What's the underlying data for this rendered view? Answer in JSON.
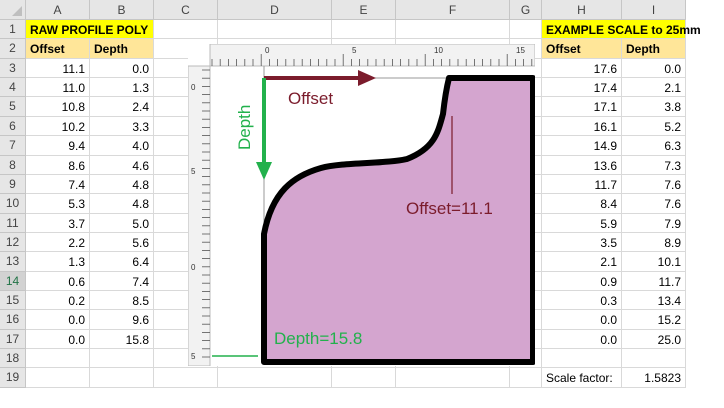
{
  "columns": [
    "A",
    "B",
    "C",
    "D",
    "E",
    "F",
    "G",
    "H",
    "I"
  ],
  "rows": [
    "1",
    "2",
    "3",
    "4",
    "5",
    "6",
    "7",
    "8",
    "9",
    "10",
    "11",
    "12",
    "13",
    "14",
    "15",
    "16",
    "17",
    "18",
    "19"
  ],
  "selected_row": "14",
  "raw": {
    "title": "RAW PROFILE POLY",
    "headers": [
      "Offset",
      "Depth"
    ],
    "data": [
      [
        "11.1",
        "0.0"
      ],
      [
        "11.0",
        "1.3"
      ],
      [
        "10.8",
        "2.4"
      ],
      [
        "10.2",
        "3.3"
      ],
      [
        "9.4",
        "4.0"
      ],
      [
        "8.6",
        "4.6"
      ],
      [
        "7.4",
        "4.8"
      ],
      [
        "5.3",
        "4.8"
      ],
      [
        "3.7",
        "5.0"
      ],
      [
        "2.2",
        "5.6"
      ],
      [
        "1.3",
        "6.4"
      ],
      [
        "0.6",
        "7.4"
      ],
      [
        "0.2",
        "8.5"
      ],
      [
        "0.0",
        "9.6"
      ],
      [
        "0.0",
        "15.8"
      ]
    ]
  },
  "scaled": {
    "title": "EXAMPLE SCALE to 25mm",
    "headers": [
      "Offset",
      "Depth"
    ],
    "data": [
      [
        "17.6",
        "0.0"
      ],
      [
        "17.4",
        "2.1"
      ],
      [
        "17.1",
        "3.8"
      ],
      [
        "16.1",
        "5.2"
      ],
      [
        "14.9",
        "6.3"
      ],
      [
        "13.6",
        "7.3"
      ],
      [
        "11.7",
        "7.6"
      ],
      [
        "8.4",
        "7.6"
      ],
      [
        "5.9",
        "7.9"
      ],
      [
        "3.5",
        "8.9"
      ],
      [
        "2.1",
        "10.1"
      ],
      [
        "0.9",
        "11.7"
      ],
      [
        "0.3",
        "13.4"
      ],
      [
        "0.0",
        "15.2"
      ],
      [
        "0.0",
        "25.0"
      ]
    ],
    "scale_label": "Scale factor:",
    "scale_value": "1.5823"
  },
  "figure": {
    "offset_label": "Offset",
    "depth_label": "Depth",
    "offset_annotation": "Offset=11.1",
    "depth_annotation": "Depth=15.8",
    "ruler_top_ticks": [
      "0",
      "5",
      "10",
      "15"
    ],
    "ruler_left_ticks": [
      "0",
      "5",
      "0",
      "5"
    ],
    "colors": {
      "fill": "#d4a5cf",
      "offset_arrow": "#7b1c2c",
      "depth_arrow": "#22b14c",
      "outline": "#000000"
    }
  }
}
